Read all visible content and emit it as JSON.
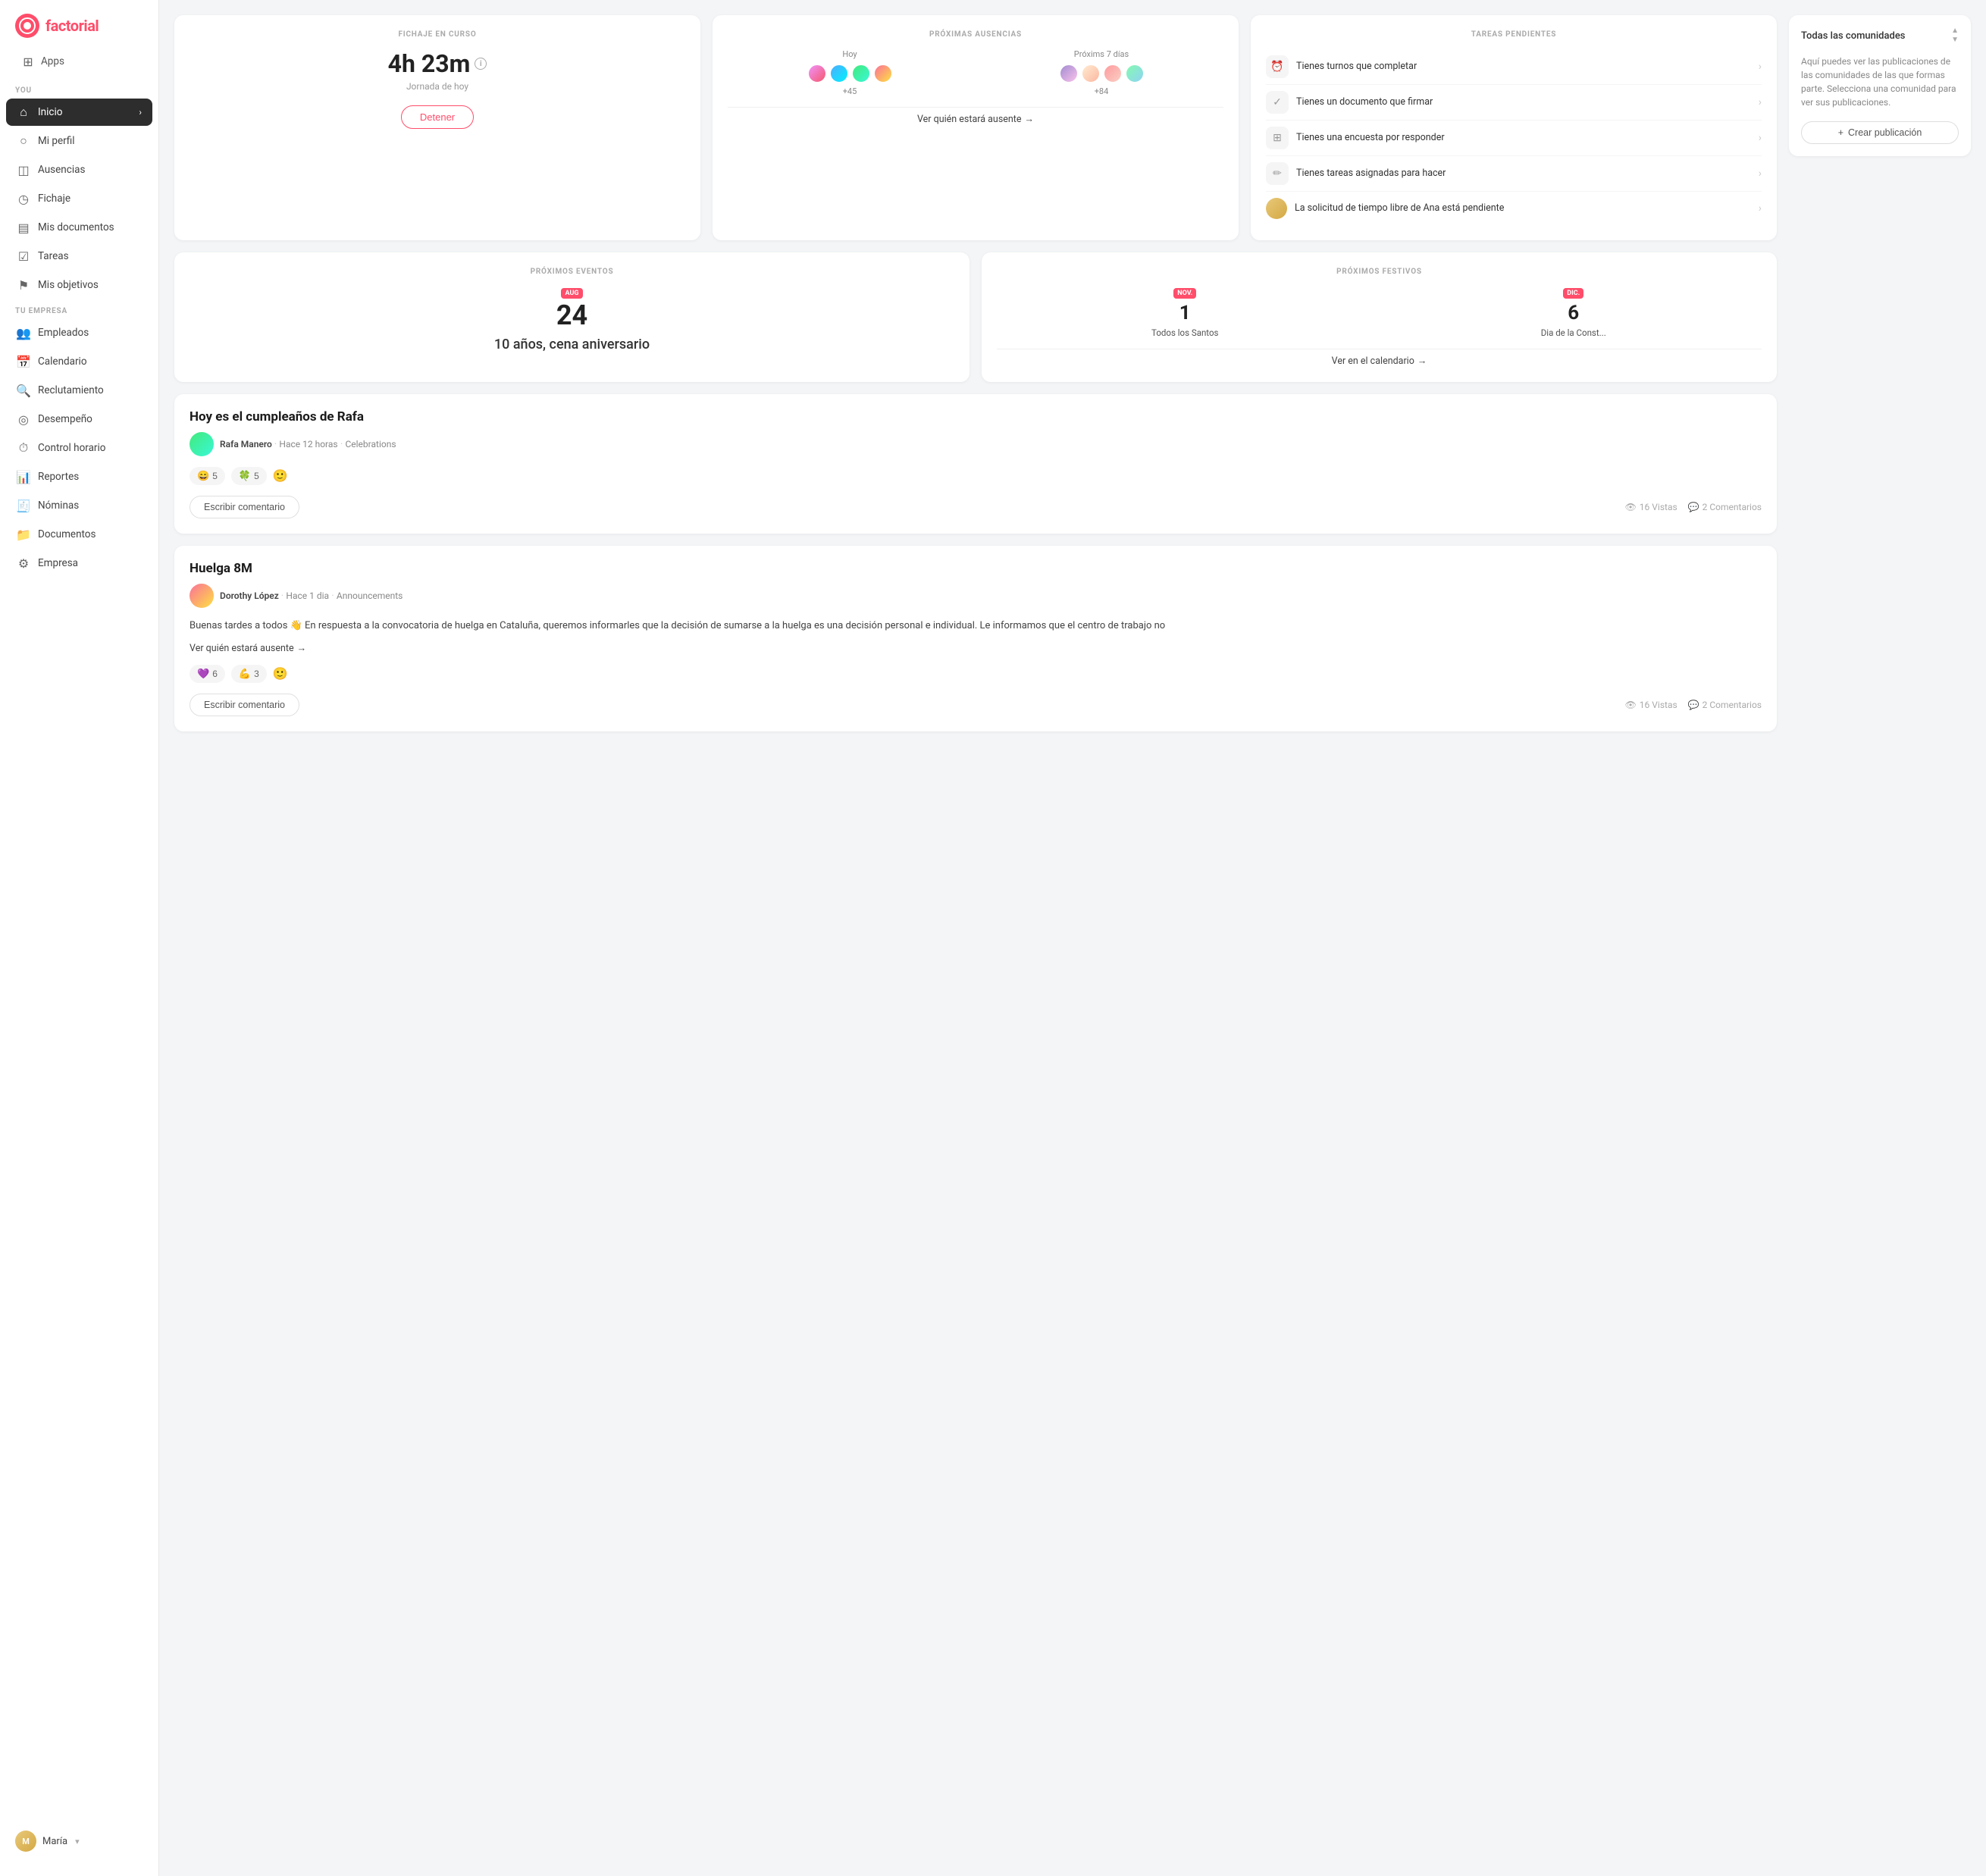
{
  "logo": {
    "text": "factorial"
  },
  "sidebar": {
    "apps_label": "Apps",
    "section_you": "YOU",
    "section_empresa": "TU EMPRESA",
    "items_you": [
      {
        "label": "Inicio",
        "icon": "home",
        "active": true
      },
      {
        "label": "Mi perfil",
        "icon": "user",
        "active": false
      },
      {
        "label": "Ausencias",
        "icon": "calendar-x",
        "active": false
      },
      {
        "label": "Fichaje",
        "icon": "clock",
        "active": false
      },
      {
        "label": "Mis documentos",
        "icon": "file",
        "active": false
      },
      {
        "label": "Tareas",
        "icon": "check-square",
        "active": false
      },
      {
        "label": "Mis objetivos",
        "icon": "flag",
        "active": false
      }
    ],
    "items_empresa": [
      {
        "label": "Empleados",
        "icon": "users",
        "active": false
      },
      {
        "label": "Calendario",
        "icon": "calendar",
        "active": false
      },
      {
        "label": "Reclutamiento",
        "icon": "search-user",
        "active": false
      },
      {
        "label": "Desempeño",
        "icon": "user-check",
        "active": false
      },
      {
        "label": "Control horario",
        "icon": "timer",
        "active": false
      },
      {
        "label": "Reportes",
        "icon": "bar-chart",
        "active": false
      },
      {
        "label": "Nóminas",
        "icon": "receipt",
        "active": false
      },
      {
        "label": "Documentos",
        "icon": "folder",
        "active": false
      },
      {
        "label": "Empresa",
        "icon": "building",
        "active": false
      }
    ],
    "user": {
      "name": "María",
      "initials": "M"
    }
  },
  "fichaje": {
    "title": "FICHAJE EN CURSO",
    "time": "4h 23m",
    "subtitle": "Jornada de hoy",
    "button": "Detener"
  },
  "ausencias": {
    "title": "PRÓXIMAS AUSENCIAS",
    "col1_label": "Hoy",
    "col2_label": "Próxims 7 días",
    "count1": "+45",
    "count2": "+84",
    "ver_link": "Ver quién estará ausente"
  },
  "tareas": {
    "title": "TAREAS PENDIENTES",
    "items": [
      {
        "text": "Tienes turnos que completar",
        "icon": "clock"
      },
      {
        "text": "Tienes un documento que firmar",
        "icon": "check"
      },
      {
        "text": "Tienes una encuesta por responder",
        "icon": "survey"
      },
      {
        "text": "Tienes tareas asignadas para hacer",
        "icon": "edit"
      },
      {
        "text": "La solicitud de tiempo libre de Ana está pendiente",
        "icon": "avatar"
      }
    ]
  },
  "eventos": {
    "title": "PRÓXIMOS EVENTOS",
    "month": "AUG",
    "day": "24",
    "description": "10 años, cena aniversario"
  },
  "festivos": {
    "title": "PRÓXIMOS FESTIVOS",
    "items": [
      {
        "month": "NOV.",
        "day": "1",
        "name": "Todos los Santos"
      },
      {
        "month": "DIC.",
        "day": "6",
        "name": "Dia de la Const..."
      }
    ],
    "ver_link": "Ver en el calendario"
  },
  "community": {
    "filter_label": "Todas las comunidades",
    "body_text": "Aquí puedes ver las publicaciones de las comunidades de las que formas parte. Selecciona una comunidad para ver sus publicaciones.",
    "crear_btn": "Crear publicación"
  },
  "posts": [
    {
      "id": "birthday",
      "title": "Hoy es el cumpleaños de Rafa",
      "author": "Rafa Manero",
      "time": "Hace 12 horas",
      "tag": "Celebrations",
      "reactions": [
        {
          "emoji": "😄",
          "count": "5"
        },
        {
          "emoji": "🍀",
          "count": "5"
        }
      ],
      "comment_btn": "Escribir comentario",
      "views": "16 Vistas",
      "comments": "2 Comentarios"
    },
    {
      "id": "huelga",
      "title": "Huelga 8M",
      "author": "Dorothy López",
      "time": "Hace 1 dia",
      "tag": "Announcements",
      "body": "Buenas tardes a todos 👋 En respuesta a la convocatoria de huelga en Cataluña, queremos informarles que la decisión de sumarse a la huelga es una decisión personal e individual. Le informamos que el centro de trabajo no",
      "ver_link": "Ver quién estará ausente",
      "reactions": [
        {
          "emoji": "💜",
          "count": "6"
        },
        {
          "emoji": "💪",
          "count": "3"
        }
      ],
      "comment_btn": "Escribir comentario",
      "views": "16 Vistas",
      "comments": "2 Comentarios"
    }
  ]
}
